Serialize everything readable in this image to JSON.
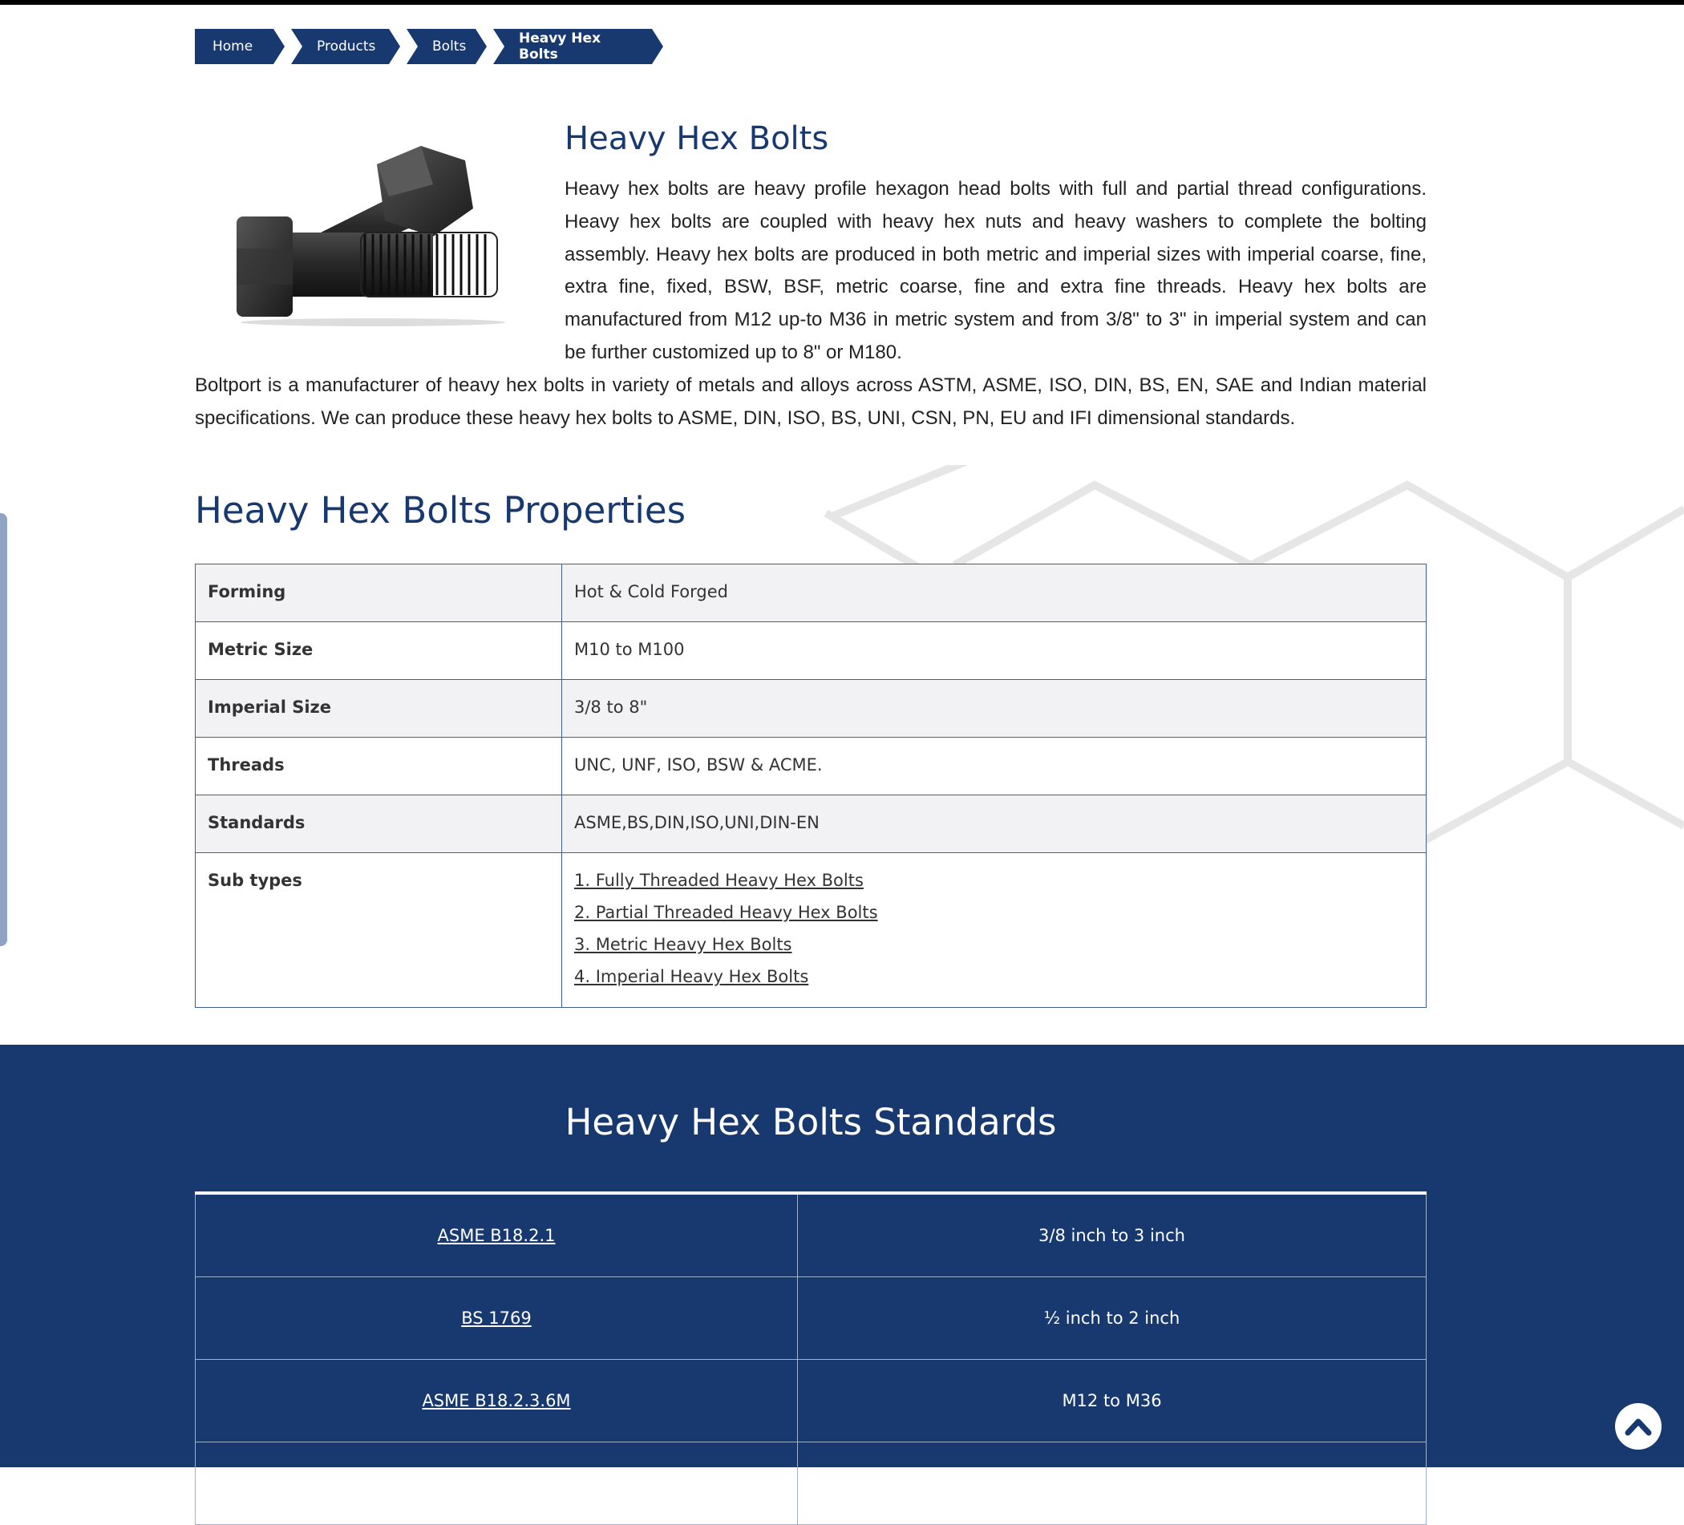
{
  "breadcrumb": {
    "items": [
      "Home",
      "Products",
      "Bolts",
      "Heavy Hex Bolts"
    ]
  },
  "product": {
    "title": "Heavy Hex Bolts",
    "description": "Heavy hex bolts are heavy profile hexagon head bolts with full and partial thread configurations. Heavy hex bolts are coupled with heavy hex nuts and heavy washers to complete the bolting assembly. Heavy hex bolts are produced in both metric and imperial sizes with imperial coarse, fine, extra fine, fixed, BSW, BSF, metric coarse, fine and extra fine threads. Heavy hex bolts are manufactured from M12 up-to M36 in metric system and from 3/8\" to 3\" in imperial system and can be further customized up to 8\" or M180.",
    "description2": "Boltport is a manufacturer of heavy hex bolts in variety of metals and alloys across ASTM, ASME, ISO, DIN, BS, EN, SAE and Indian material specifications. We can produce these heavy hex bolts to ASME, DIN, ISO, BS, UNI, CSN, PN, EU and IFI dimensional standards."
  },
  "properties": {
    "heading": "Heavy Hex Bolts Properties",
    "rows": [
      {
        "key": "Forming",
        "value": "Hot & Cold Forged"
      },
      {
        "key": "Metric Size",
        "value": "M10 to M100"
      },
      {
        "key": "Imperial Size",
        "value": "3/8 to 8\""
      },
      {
        "key": "Threads",
        "value": "UNC, UNF, ISO, BSW & ACME."
      },
      {
        "key": "Standards",
        "value": "ASME,BS,DIN,ISO,UNI,DIN-EN"
      }
    ],
    "subtypes_label": "Sub types",
    "subtypes": [
      "1. Fully Threaded Heavy Hex Bolts",
      "2. Partial Threaded Heavy Hex Bolts",
      "3. Metric Heavy Hex Bolts",
      "4. Imperial Heavy Hex Bolts"
    ]
  },
  "standards": {
    "heading": "Heavy Hex Bolts Standards",
    "rows": [
      {
        "standard": "ASME B18.2.1",
        "range": "3/8 inch to 3 inch"
      },
      {
        "standard": "BS 1769",
        "range": "½ inch to 2 inch"
      },
      {
        "standard": "ASME B18.2.3.6M",
        "range": "M12 to M36"
      }
    ]
  },
  "icons": {
    "scroll_top": "chevron-up-icon",
    "product_image": "heavy-hex-bolt-image"
  },
  "colors": {
    "brand": "#17396f",
    "background": "#ffffff"
  }
}
